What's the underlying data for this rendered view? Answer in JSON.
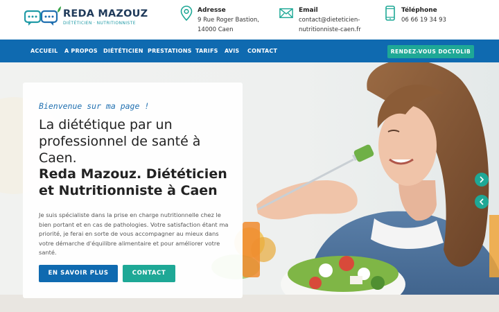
{
  "brand": {
    "name": "REDA MAZOUZ",
    "tagline": "DIÉTÉTICIEN · NUTRITIONNISTE"
  },
  "contacts": {
    "address": {
      "title": "Adresse",
      "line1": "9 Rue Roger Bastion,",
      "line2": "14000 Caen",
      "icon": "map-pin-icon"
    },
    "email": {
      "title": "Email",
      "line1": "contact@dieteticien-",
      "line2": "nutritionniste-caen.fr",
      "icon": "envelope-icon"
    },
    "phone": {
      "title": "Téléphone",
      "line1": "06 66 19 34 93",
      "icon": "phone-icon"
    }
  },
  "nav": {
    "items": [
      "ACCUEIL",
      "A PROPOS",
      "DIÉTÉTICIEN",
      "PRESTATIONS",
      "TARIFS",
      "AVIS",
      "CONTACT"
    ],
    "cta": "RENDEZ-VOUS DOCTOLIB"
  },
  "hero": {
    "welcome": "Bienvenue sur ma page !",
    "headline": "La diététique par un professionnel de santé à Caen.",
    "headline_bold": "Reda Mazouz. Diététicien et Nutritionniste à Caen",
    "intro": "Je suis spécialiste dans la prise en charge nutritionnelle chez le bien portant et en cas de pathologies. Votre satisfaction étant ma priorité, je ferai en sorte de vous accompagner au mieux dans votre démarche d'équilibre alimentaire et pour améliorer votre santé.",
    "btn_more": "EN SAVOIR PLUS",
    "btn_contact": "CONTACT"
  },
  "colors": {
    "primary": "#0f6ab0",
    "accent": "#1ea896",
    "dark": "#1f3a5a"
  }
}
